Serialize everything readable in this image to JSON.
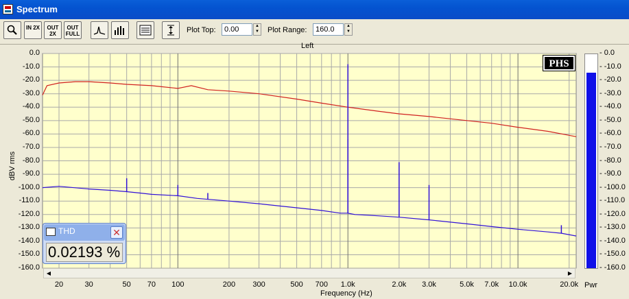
{
  "window": {
    "title": "Spectrum",
    "icon": "spectrum-app-icon"
  },
  "toolbar": {
    "buttons": [
      {
        "name": "zoom-button",
        "icon": "magnifier-icon"
      },
      {
        "name": "zoom-in-2x-button",
        "label": "IN 2X"
      },
      {
        "name": "zoom-out-2x-button",
        "label": "OUT 2X"
      },
      {
        "name": "zoom-out-full-button",
        "label": "OUT FULL"
      },
      {
        "name": "peak-button",
        "icon": "peak-icon"
      },
      {
        "name": "bars-button",
        "icon": "bars-icon"
      },
      {
        "name": "settings-button",
        "icon": "list-icon"
      },
      {
        "name": "autoscale-button",
        "icon": "vertical-range-icon"
      }
    ],
    "plot_top_label": "Plot Top:",
    "plot_top_value": "0.00",
    "plot_range_label": "Plot Range:",
    "plot_range_value": "160.0"
  },
  "chart_data": {
    "type": "line",
    "title": "Left",
    "xlabel": "Frequency (Hz)",
    "ylabel": "dBV rms",
    "xscale": "log",
    "xlim": [
      16,
      22000
    ],
    "ylim": [
      -160,
      0
    ],
    "grid": true,
    "y_ticks": [
      "0.0",
      "-10.0",
      "-20.0",
      "-30.0",
      "-40.0",
      "-50.0",
      "-60.0",
      "-70.0",
      "-80.0",
      "-90.0",
      "-100.0",
      "-110.0",
      "-120.0",
      "-130.0",
      "-140.0",
      "-150.0",
      "-160.0"
    ],
    "x_ticks": [
      {
        "v": 20,
        "label": "20"
      },
      {
        "v": 30,
        "label": "30"
      },
      {
        "v": 50,
        "label": "50"
      },
      {
        "v": 70,
        "label": "70"
      },
      {
        "v": 100,
        "label": "100"
      },
      {
        "v": 200,
        "label": "200"
      },
      {
        "v": 300,
        "label": "300"
      },
      {
        "v": 500,
        "label": "500"
      },
      {
        "v": 700,
        "label": "700"
      },
      {
        "v": 1000,
        "label": "1.0k"
      },
      {
        "v": 2000,
        "label": "2.0k"
      },
      {
        "v": 3000,
        "label": "3.0k"
      },
      {
        "v": 5000,
        "label": "5.0k"
      },
      {
        "v": 7000,
        "label": "7.0k"
      },
      {
        "v": 10000,
        "label": "10.0k"
      },
      {
        "v": 20000,
        "label": "20.0k"
      }
    ],
    "series": [
      {
        "color": "#d02020",
        "x": [
          16,
          17,
          20,
          25,
          30,
          40,
          50,
          70,
          100,
          120,
          150,
          200,
          300,
          500,
          700,
          1000,
          1500,
          2000,
          3000,
          5000,
          7000,
          10000,
          15000,
          20000,
          22000
        ],
        "y": [
          -31,
          -24,
          -22,
          -21,
          -21,
          -22,
          -23,
          -24,
          -26,
          -24,
          -27,
          -28,
          -30,
          -34,
          -37,
          -40,
          -43,
          -45,
          -47,
          -50,
          -52,
          -55,
          -58,
          -61,
          -62
        ]
      },
      {
        "color": "#3010d8",
        "x": [
          16,
          20,
          30,
          40,
          50,
          60,
          70,
          100,
          130,
          160,
          200,
          300,
          500,
          700,
          900,
          1000,
          1100,
          1500,
          2000,
          3000,
          5000,
          7000,
          10000,
          15000,
          18000,
          22000
        ],
        "y": [
          -100,
          -99,
          -101,
          -102,
          -103,
          -104,
          -105,
          -106,
          -108,
          -109,
          -110,
          -112,
          -115,
          -117,
          -119,
          -119,
          -120,
          -121,
          -122,
          -124,
          -127,
          -129,
          -131,
          -133,
          -134,
          -136
        ]
      }
    ],
    "peaks": [
      {
        "x": 50,
        "y": -93,
        "color": "#3010d8"
      },
      {
        "x": 100,
        "y": -98,
        "color": "#3010d8"
      },
      {
        "x": 150,
        "y": -104,
        "color": "#3010d8"
      },
      {
        "x": 1000,
        "y": -8,
        "color": "#3010d8"
      },
      {
        "x": 1000,
        "y": -64,
        "color": "#3010d8"
      },
      {
        "x": 2000,
        "y": -81,
        "color": "#3010d8"
      },
      {
        "x": 3000,
        "y": -98,
        "color": "#3010d8"
      },
      {
        "x": 18000,
        "y": -128,
        "color": "#3010d8"
      }
    ]
  },
  "meter": {
    "level_fraction": 0.95,
    "ticks": [
      "0.0",
      "-10.0",
      "-20.0",
      "-30.0",
      "-40.0",
      "-50.0",
      "-60.0",
      "-70.0",
      "-80.0",
      "-90.0",
      "-100.0",
      "-110.0",
      "-120.0",
      "-130.0",
      "-140.0",
      "-150.0",
      "-160.0"
    ],
    "label": "Pwr",
    "color": "#1010e8"
  },
  "logo": "PHS",
  "thd": {
    "title": "THD",
    "value": "0.02193 %"
  }
}
